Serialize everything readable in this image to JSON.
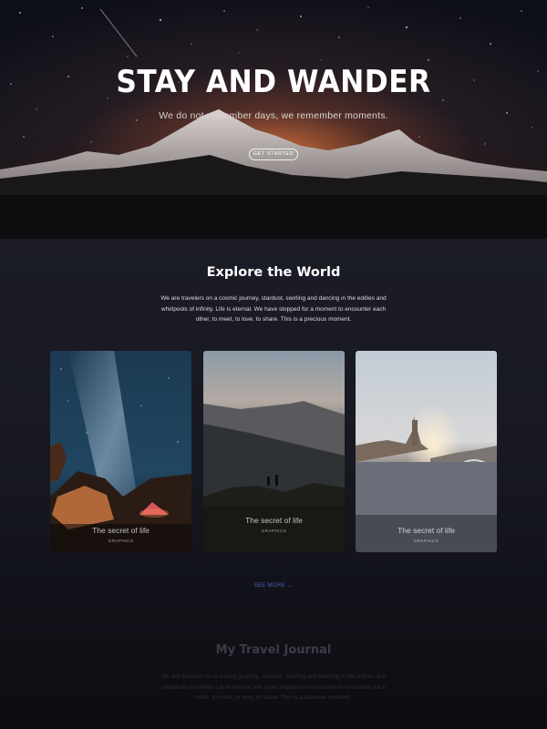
{
  "hero": {
    "title": "STAY AND WANDER",
    "subtitle": "We do not remember days, we remember moments.",
    "cta_label": "GET STARTED"
  },
  "explore": {
    "title": "Explore the World",
    "text": "We are travelers on a cosmic journey, stardust, swirling and dancing in the eddies and whirlpools of infinity. Life is eternal. We have stopped for a moment to encounter each other, to meet, to love, to share. This is a precious moment.",
    "cards": [
      {
        "title": "The secret of life",
        "tag": "GRAPHICS"
      },
      {
        "title": "The secret of life",
        "tag": "GRAPHICS"
      },
      {
        "title": "The secret of life",
        "tag": "GRAPHICS"
      }
    ],
    "see_more_label": "SEE MORE →"
  },
  "journal": {
    "title": "My Travel Journal",
    "text": "We are travelers on a cosmic journey, stardust, swirling and dancing in the eddies and whirlpools of infinity. Life is eternal. We have stopped for a moment to encounter each other, to meet, to love, to share. This is a precious moment."
  },
  "colors": {
    "accent_link": "#4a5fbf",
    "page_bg": "#171821"
  }
}
